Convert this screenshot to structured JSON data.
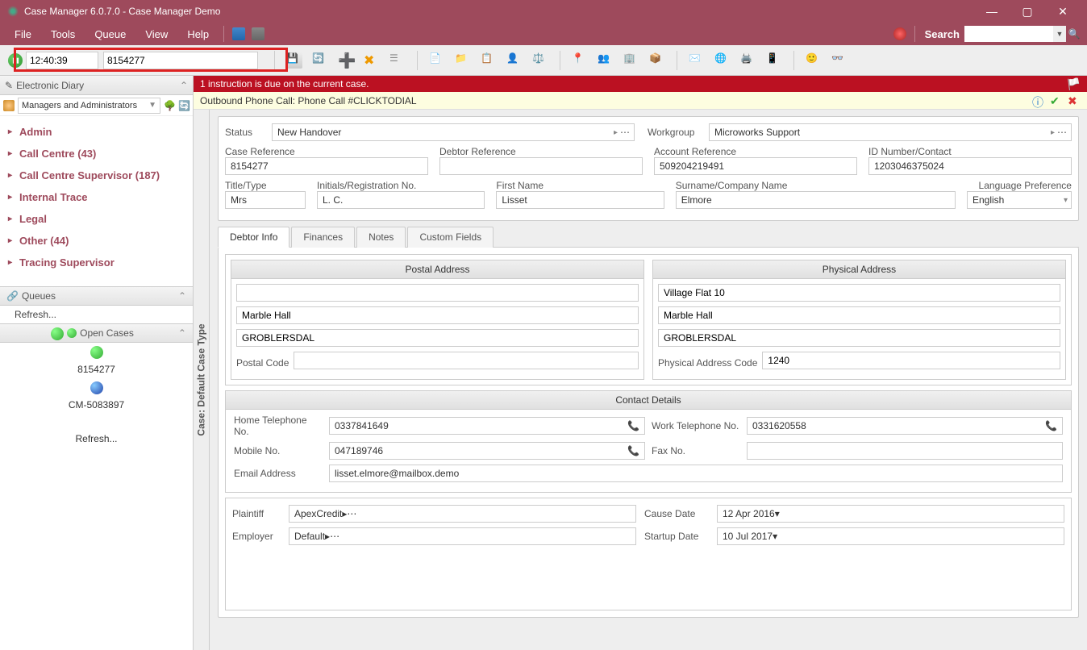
{
  "app": {
    "title": "Case Manager 6.0.7.0 - Case Manager Demo"
  },
  "menu": {
    "file": "File",
    "tools": "Tools",
    "queue": "Queue",
    "view": "View",
    "help": "Help",
    "search_label": "Search",
    "search_value": ""
  },
  "toolbar": {
    "time": "12:40:39",
    "case_no": "8154277"
  },
  "alert": {
    "text": "1 instruction is due on the current case."
  },
  "yellow": {
    "text": "Outbound Phone Call: Phone Call #CLICKTODIAL"
  },
  "sidebar": {
    "diary_title": "Electronic Diary",
    "filter_combo": "Managers and Administrators",
    "tree": [
      {
        "label": "Admin"
      },
      {
        "label": "Call Centre (43)"
      },
      {
        "label": "Call Centre Supervisor (187)"
      },
      {
        "label": "Internal Trace"
      },
      {
        "label": "Legal"
      },
      {
        "label": "Other (44)"
      },
      {
        "label": "Tracing Supervisor"
      }
    ],
    "queues_title": "Queues",
    "refresh": "Refresh...",
    "opencases_title": "Open Cases",
    "open_items": [
      {
        "ball": "green",
        "label": "8154277"
      },
      {
        "ball": "blue",
        "label": "CM-5083897"
      }
    ]
  },
  "midlabel": "Case: Default Case Type",
  "form": {
    "status_label": "Status",
    "status_value": "New Handover",
    "workgroup_label": "Workgroup",
    "workgroup_value": "Microworks Support",
    "caseref_label": "Case Reference",
    "caseref_value": "8154277",
    "debtorref_label": "Debtor Reference",
    "debtorref_value": "",
    "accref_label": "Account Reference",
    "accref_value": "509204219491",
    "idno_label": "ID Number/Contact",
    "idno_value": "1203046375024",
    "title_label": "Title/Type",
    "title_value": "Mrs",
    "initials_label": "Initials/Registration No.",
    "initials_value": "L. C.",
    "firstname_label": "First Name",
    "firstname_value": "Lisset",
    "surname_label": "Surname/Company Name",
    "surname_value": "Elmore",
    "lang_label": "Language Preference",
    "lang_value": "English",
    "tabs": {
      "debtor": "Debtor Info",
      "finances": "Finances",
      "notes": "Notes",
      "custom": "Custom Fields"
    },
    "postal": {
      "title": "Postal Address",
      "line1": "",
      "line2": "Marble Hall",
      "line3": "GROBLERSDAL",
      "pc_label": "Postal Code",
      "pc_value": ""
    },
    "physical": {
      "title": "Physical Address",
      "line1": "Village Flat 10",
      "line2": "Marble Hall",
      "line3": "GROBLERSDAL",
      "pc_label": "Physical Address Code",
      "pc_value": "1240"
    },
    "contact": {
      "title": "Contact Details",
      "home_label": "Home Telephone No.",
      "home_value": "0337841649",
      "work_label": "Work Telephone No.",
      "work_value": "0331620558",
      "mobile_label": "Mobile No.",
      "mobile_value": "047189746",
      "fax_label": "Fax No.",
      "fax_value": "",
      "email_label": "Email Address",
      "email_value": "lisset.elmore@mailbox.demo"
    },
    "bottom": {
      "plaintiff_label": "Plaintiff",
      "plaintiff_value": "ApexCredit",
      "causedate_label": "Cause Date",
      "causedate_value": "12 Apr 2016",
      "employer_label": "Employer",
      "employer_value": "Default",
      "startup_label": "Startup Date",
      "startup_value": "10 Jul 2017"
    }
  }
}
